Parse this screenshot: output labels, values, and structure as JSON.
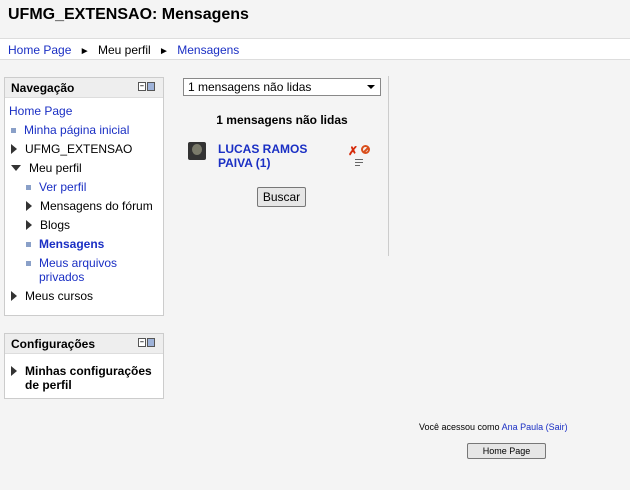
{
  "page": {
    "title": "UFMG_EXTENSAO: Mensagens"
  },
  "breadcrumb": {
    "home": "Home Page",
    "separator": "►",
    "profile": "Meu perfil",
    "current": "Mensagens"
  },
  "navigation": {
    "title": "Navegação",
    "home": "Home Page",
    "items": [
      {
        "label": "Minha página inicial"
      },
      {
        "label": "UFMG_EXTENSAO"
      },
      {
        "label": "Meu perfil"
      },
      {
        "label": "Ver perfil"
      },
      {
        "label": "Mensagens do fórum"
      },
      {
        "label": "Blogs"
      },
      {
        "label": "Mensagens"
      },
      {
        "label": "Meus arquivos privados"
      },
      {
        "label": "Meus cursos"
      }
    ]
  },
  "settings": {
    "title": "Configurações",
    "items": [
      {
        "label": "Minhas configurações de perfil"
      }
    ]
  },
  "messages": {
    "select_value": "1 mensagens não lidas",
    "heading": "1 mensagens não lidas",
    "contact_name": "LUCAS RAMOS PAIVA (1)",
    "remove_glyph": "✗",
    "search_button": "Buscar"
  },
  "footer": {
    "login_prefix": "Você acessou como",
    "user": "Ana Paula",
    "logout": "(Sair)",
    "home_button": "Home Page"
  },
  "colors": {
    "link": "#1a2fc4",
    "remove": "#d62a0a",
    "block": "#d94f1c"
  }
}
